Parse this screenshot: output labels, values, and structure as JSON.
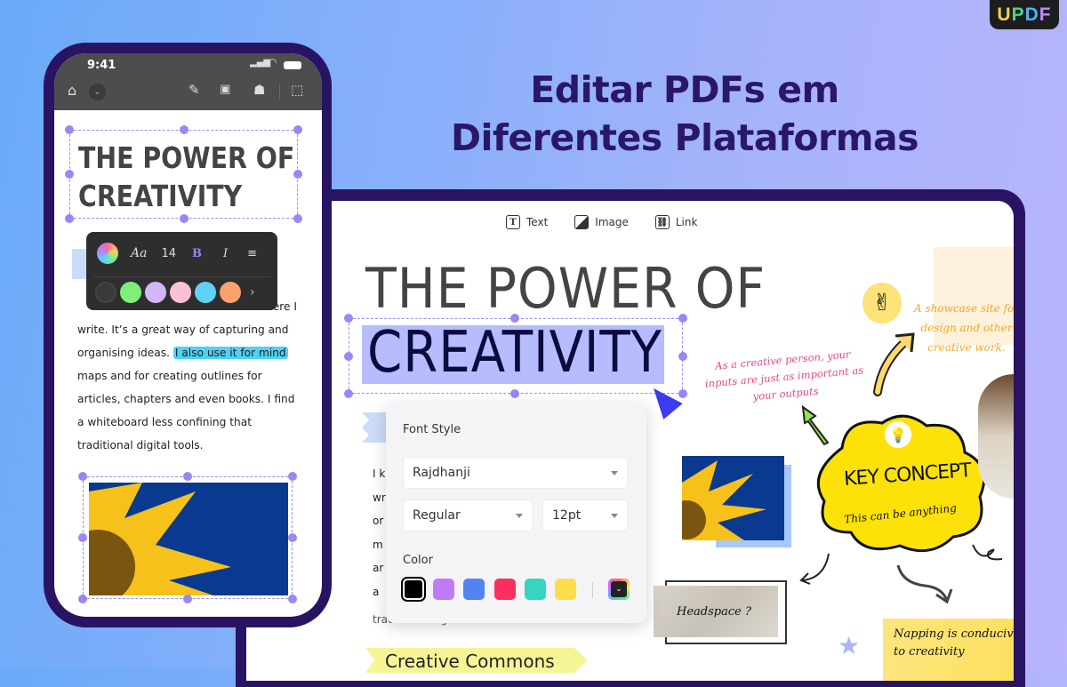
{
  "brand": {
    "logo_letters": [
      "U",
      "P",
      "D",
      "F"
    ]
  },
  "headline": {
    "line1": "Editar PDFs em",
    "line2": "Diferentes Plataformas"
  },
  "phone": {
    "status_time": "9:41",
    "toolbar_icons": [
      "home-icon",
      "chevron-down-icon",
      "highlighter-icon",
      "text-image-icon",
      "image-edit-icon",
      "select-touch-icon"
    ],
    "doc_title_line1": "THE POWER OF",
    "doc_title_line2": "CREATIVITY",
    "format_toolbar": {
      "font_label": "Aa",
      "font_size": "14",
      "bold_label": "B",
      "italic_label": "I",
      "colors": [
        "#7ef07a",
        "#d4b5fa",
        "#fbc1d3",
        "#5fd3f6",
        "#f9a26f"
      ],
      "more_label": "›"
    },
    "body": {
      "line1_end": "here I",
      "line2": "write. It’s a great way of capturing and",
      "line3_pre": "organising ideas. ",
      "line3_highlight": "I also use it for mind",
      "line4": "maps and for creating outlines for",
      "line5": "articles, chapters and even books. I find",
      "line6": "a whiteboard less confining that",
      "line7": "traditional digital tools."
    }
  },
  "desktop": {
    "toolbar": {
      "text_label": "Text",
      "image_label": "Image",
      "link_label": "Link"
    },
    "doc_title_line1": "THE POWER OF",
    "doc_title_line2": "CREATIVITY",
    "body_fragments": [
      "I k",
      "wr",
      "or",
      "m",
      "ar",
      "a",
      "tra"
    ],
    "body_last": "traditional digital tools.",
    "section_heading": "Creative Commons",
    "font_popup": {
      "title": "Font Style",
      "font_family": "Rajdhanji",
      "font_weight": "Regular",
      "font_size": "12pt",
      "color_label": "Color",
      "colors": [
        "#000000",
        "#bf7bf5",
        "#5283f3",
        "#fb2f5f",
        "#36d5bf",
        "#fddd4a"
      ],
      "selected_color": "#000000"
    },
    "notes": {
      "pink": "As a creative person, your inputs are just as important as your outputs",
      "orange": "A showcase site for design and other creative work.",
      "key_concept": "KEY CONCEPT",
      "key_concept_sub": "This can be anything",
      "headspace": "Headspace ?",
      "napping": "Napping is conducive to creativity"
    }
  }
}
